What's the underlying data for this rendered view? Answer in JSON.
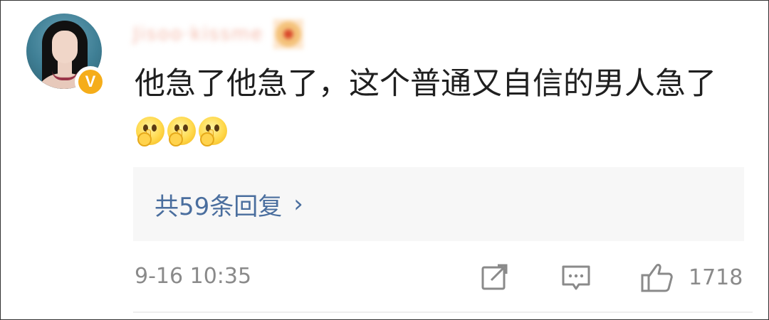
{
  "user": {
    "username": "Jisoo·kissme",
    "verified_badge": "V"
  },
  "comment": {
    "text": "他急了他急了，这个普通又自信的男人急了"
  },
  "replies": {
    "label": "共59条回复",
    "chevron": "›"
  },
  "meta": {
    "timestamp": "9-16 10:35",
    "like_count": "1718"
  },
  "colors": {
    "link": "#4a6e9e",
    "secondary": "#8a8a8a",
    "verified": "#f5ad1a",
    "reply_bg": "#f7f7f7"
  }
}
